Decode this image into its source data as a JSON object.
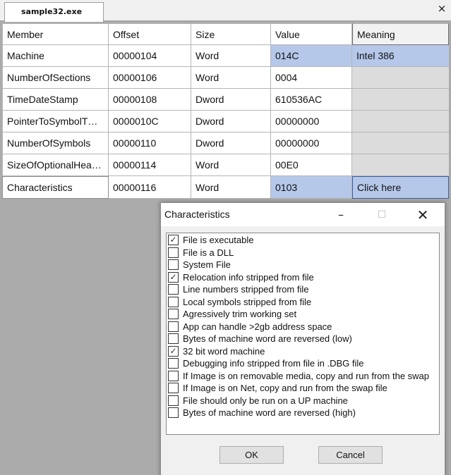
{
  "tab": {
    "title": "sample32.exe",
    "close_glyph": "×"
  },
  "table": {
    "headers": [
      "Member",
      "Offset",
      "Size",
      "Value",
      "Meaning"
    ],
    "rows": [
      {
        "member": "Machine",
        "offset": "00000104",
        "size": "Word",
        "value": "014C",
        "meaning": "Intel 386"
      },
      {
        "member": "NumberOfSections",
        "offset": "00000106",
        "size": "Word",
        "value": "0004",
        "meaning": ""
      },
      {
        "member": "TimeDateStamp",
        "offset": "00000108",
        "size": "Dword",
        "value": "610536AC",
        "meaning": ""
      },
      {
        "member": "PointerToSymbolT…",
        "offset": "0000010C",
        "size": "Dword",
        "value": "00000000",
        "meaning": ""
      },
      {
        "member": "NumberOfSymbols",
        "offset": "00000110",
        "size": "Dword",
        "value": "00000000",
        "meaning": ""
      },
      {
        "member": "SizeOfOptionalHea…",
        "offset": "00000114",
        "size": "Word",
        "value": "00E0",
        "meaning": ""
      },
      {
        "member": "Characteristics",
        "offset": "00000116",
        "size": "Word",
        "value": "0103",
        "meaning": "Click here"
      }
    ]
  },
  "dialog": {
    "title": "Characteristics",
    "minimize_glyph": "–",
    "maximize_glyph": "☐",
    "close_glyph": "✕",
    "check_glyph": "✓",
    "options": [
      {
        "label": "File is executable",
        "checked": true
      },
      {
        "label": "File is a DLL",
        "checked": false
      },
      {
        "label": "System File",
        "checked": false
      },
      {
        "label": "Relocation info stripped from file",
        "checked": true
      },
      {
        "label": "Line numbers stripped from file",
        "checked": false
      },
      {
        "label": "Local symbols stripped from file",
        "checked": false
      },
      {
        "label": "Agressively trim working set",
        "checked": false
      },
      {
        "label": "App can handle >2gb address space",
        "checked": false
      },
      {
        "label": "Bytes of machine word are reversed (low)",
        "checked": false
      },
      {
        "label": "32 bit word machine",
        "checked": true
      },
      {
        "label": "Debugging info stripped from file in .DBG file",
        "checked": false
      },
      {
        "label": "If Image is on removable media, copy and run from the swap",
        "checked": false
      },
      {
        "label": "If Image is on Net, copy and run from the swap file",
        "checked": false
      },
      {
        "label": "File should only be run on a UP machine",
        "checked": false
      },
      {
        "label": "Bytes of machine word are reversed (high)",
        "checked": false
      }
    ],
    "ok_label": "OK",
    "cancel_label": "Cancel"
  }
}
